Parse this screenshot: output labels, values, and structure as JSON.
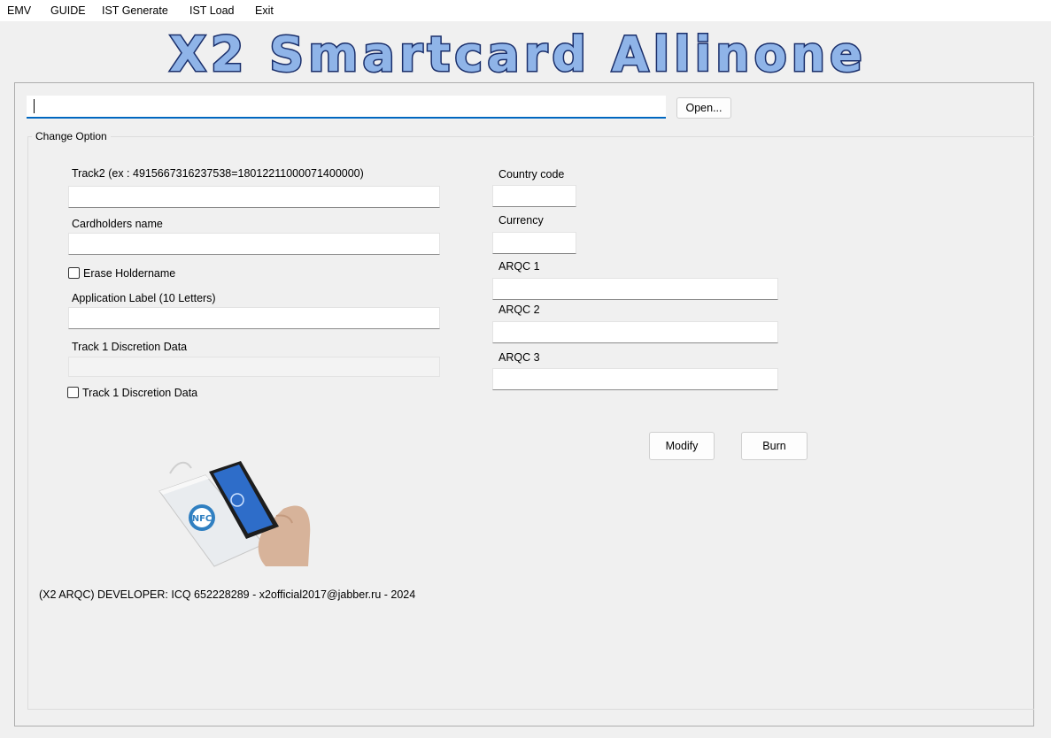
{
  "menu": [
    "EMV",
    "GUIDE",
    "IST Generate",
    "IST Load",
    "Exit"
  ],
  "banner": {
    "title": "X2 Smartcard Allinone"
  },
  "file": {
    "path_value": "",
    "open_label": "Open..."
  },
  "group": {
    "title": "Change Option"
  },
  "left": {
    "track2_label": "Track2 (ex : 4915667316237538=18012211000071400000)",
    "cardholder_label": "Cardholders name",
    "erase_label": "Erase Holdername",
    "app_label_label": "Application Label (10 Letters)",
    "track1_label": "Track 1 Discretion Data",
    "track1_check_label": "Track 1 Discretion Data"
  },
  "right": {
    "country_label": "Country code",
    "currency_label": "Currency",
    "arqc1_label": "ARQC 1",
    "arqc2_label": "ARQC 2",
    "arqc3_label": "ARQC 3"
  },
  "actions": {
    "modify_label": "Modify",
    "burn_label": "Burn"
  },
  "footer": {
    "text": "(X2 ARQC) DEVELOPER: ICQ 652228289 - x2official2017@jabber.ru - 2024"
  },
  "colors": {
    "banner_fill": "#8fb4e8",
    "banner_outline": "#1a2f6b",
    "focus_accent": "#0067c0"
  },
  "image": {
    "icon": "nfc-reader-phone-illustration"
  }
}
